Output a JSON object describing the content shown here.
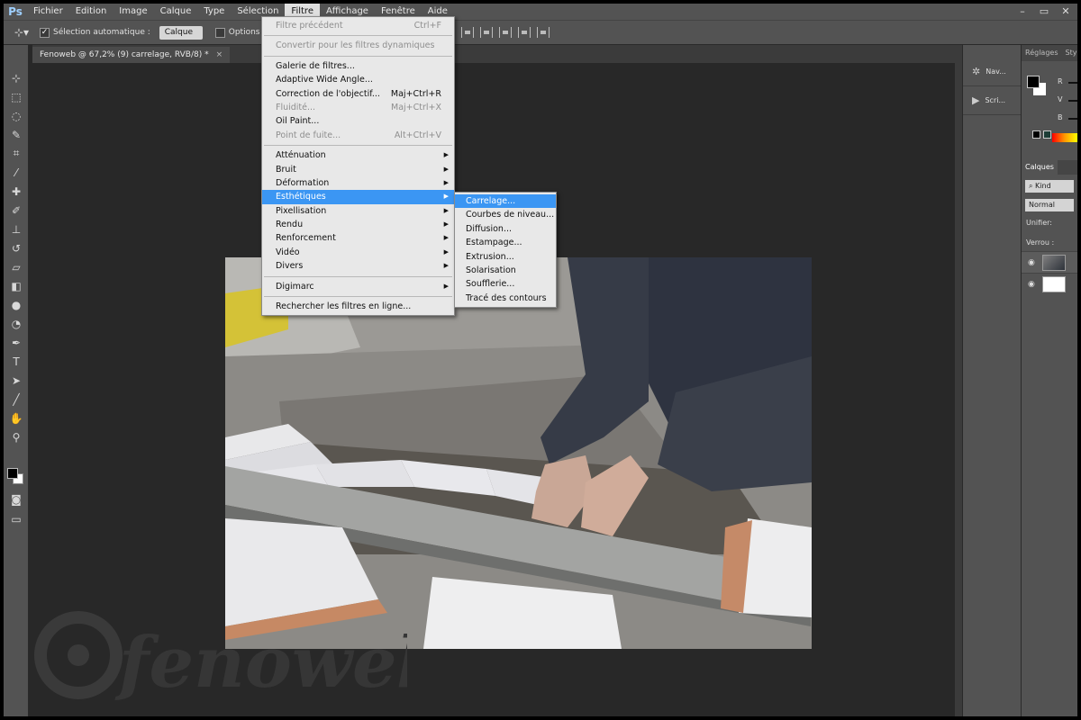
{
  "app": {
    "logo": "Ps"
  },
  "menubar": {
    "items": [
      "Fichier",
      "Edition",
      "Image",
      "Calque",
      "Type",
      "Sélection",
      "Filtre",
      "Affichage",
      "Fenêtre",
      "Aide"
    ],
    "active_index": 6,
    "window_controls": [
      "–",
      "▭",
      "✕"
    ]
  },
  "options": {
    "auto_select_label": "Sélection automatique :",
    "auto_select_value": "Calque",
    "options_label": "Options de"
  },
  "document": {
    "tab_title": "Fenoweb @ 67,2% (9) carrelage, RVB/8) *",
    "close": "×"
  },
  "filter_menu": {
    "items": [
      {
        "label": "Filtre précédent",
        "shortcut": "Ctrl+F",
        "disabled": true
      },
      {
        "sep": true
      },
      {
        "label": "Convertir pour les filtres dynamiques",
        "disabled": true
      },
      {
        "sep": true
      },
      {
        "label": "Galerie de filtres..."
      },
      {
        "label": "Adaptive Wide Angle..."
      },
      {
        "label": "Correction de l'objectif...",
        "shortcut": "Maj+Ctrl+R"
      },
      {
        "label": "Fluidité...",
        "shortcut": "Maj+Ctrl+X",
        "disabled": true
      },
      {
        "label": "Oil Paint..."
      },
      {
        "label": "Point de fuite...",
        "shortcut": "Alt+Ctrl+V",
        "disabled": true
      },
      {
        "sep": true
      },
      {
        "label": "Atténuation",
        "submenu": true
      },
      {
        "label": "Bruit",
        "submenu": true
      },
      {
        "label": "Déformation",
        "submenu": true
      },
      {
        "label": "Esthétiques",
        "submenu": true,
        "highlighted": true
      },
      {
        "label": "Pixellisation",
        "submenu": true
      },
      {
        "label": "Rendu",
        "submenu": true
      },
      {
        "label": "Renforcement",
        "submenu": true
      },
      {
        "label": "Vidéo",
        "submenu": true
      },
      {
        "label": "Divers",
        "submenu": true
      },
      {
        "sep": true
      },
      {
        "label": "Digimarc",
        "submenu": true
      },
      {
        "sep": true
      },
      {
        "label": "Rechercher les filtres en ligne..."
      }
    ]
  },
  "stylize_submenu": {
    "items": [
      "Carrelage...",
      "Courbes de niveau...",
      "Diffusion...",
      "Estampage...",
      "Extrusion...",
      "Solarisation",
      "Soufflerie...",
      "Tracé des contours"
    ],
    "highlighted_index": 0
  },
  "mini_panel": {
    "items": [
      {
        "label": "Nav...",
        "icon": "navigator-icon"
      },
      {
        "label": "Scri...",
        "icon": "play-icon"
      }
    ]
  },
  "right_panel": {
    "tabs": [
      "Réglages",
      "Styl"
    ],
    "color_rows": [
      "R",
      "V",
      "B"
    ],
    "layers_tab": "Calques",
    "filter_kind": "Kind",
    "blend_mode": "Normal",
    "unify_label": "Unifier:",
    "lock_label": "Verrou :"
  },
  "watermark_text": "fenoweb",
  "colors": {
    "highlight": "#3b96f3",
    "menu_bg": "#e8e8e8",
    "ui_panel": "#535353",
    "canvas_bg": "#282828"
  }
}
